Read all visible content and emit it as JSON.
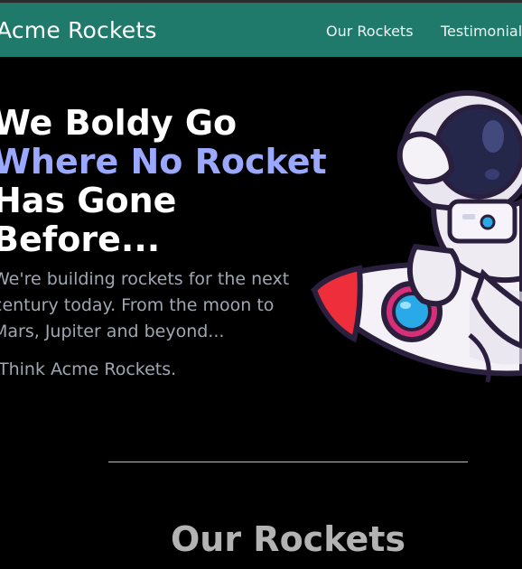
{
  "navbar": {
    "brand": "Acme Rockets",
    "links": [
      "Our Rockets",
      "Testimonials"
    ]
  },
  "hero": {
    "headline": {
      "line1": "We Boldy Go",
      "line2": "Where No Rocket",
      "line3": "Has Gone",
      "line4": "Before..."
    },
    "lead": {
      "line1": "We're building rockets for the next",
      "line2": "century today. From the moon to",
      "line3": "Mars, Jupiter and beyond..."
    },
    "signoff": "Think Acme Rockets."
  },
  "section": {
    "title": "Our Rockets"
  },
  "illustration": {
    "icon": "astronaut-riding-rocket-icon"
  },
  "colors": {
    "navbar_bg": "#1f7a6b",
    "page_bg": "#000000",
    "headline_accent": "#9aa8ff",
    "body_text": "#9fa7b2"
  }
}
